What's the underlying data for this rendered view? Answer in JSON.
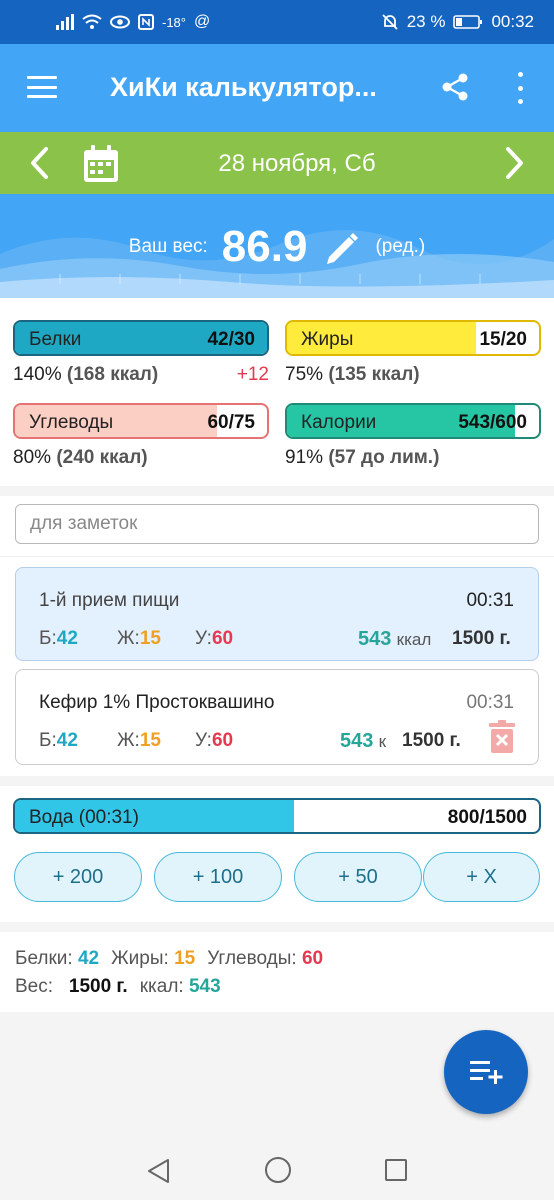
{
  "status_bar": {
    "temperature": "-18°",
    "battery": "23 %",
    "time": "00:32"
  },
  "app_bar": {
    "title": "ХиКи калькулятор..."
  },
  "date_bar": {
    "date": "28 ноября, Сб"
  },
  "weight": {
    "label": "Ваш вес:",
    "value": "86.9",
    "edit_label": "(ред.)"
  },
  "macros": {
    "protein": {
      "label": "Белки",
      "value": "42/30",
      "percent_text": "140%",
      "kcal_text": "(168 ккал)",
      "diff": "+12",
      "fill": 1.0,
      "color": "#1fa8c4",
      "border": "#1a6680"
    },
    "fat": {
      "label": "Жиры",
      "value": "15/20",
      "percent_text": "75%",
      "kcal_text": "(135 ккал)",
      "fill": 0.75,
      "color": "#ffeb3b",
      "border": "#e0b800"
    },
    "carbs": {
      "label": "Углеводы",
      "value": "60/75",
      "percent_text": "80%",
      "kcal_text": "(240 ккал)",
      "fill": 0.8,
      "color": "#fccfc5",
      "border": "#e57373"
    },
    "calories": {
      "label": "Калории",
      "value": "543/600",
      "percent_text": "91%",
      "kcal_text": "(57 до лим.)",
      "fill": 0.905,
      "color": "#26c6a5",
      "border": "#1f8a75"
    }
  },
  "notes": {
    "placeholder": "для заметок"
  },
  "meal_summary": {
    "title": "1-й прием пищи",
    "time": "00:31",
    "b_label": "Б:",
    "b_value": "42",
    "z_label": "Ж:",
    "z_value": "15",
    "u_label": "У:",
    "u_value": "60",
    "kcal_value": "543",
    "kcal_unit": "ккал",
    "weight": "1500 г."
  },
  "meal_item": {
    "title": "Кефир 1% Простоквашино",
    "time": "00:31",
    "b_label": "Б:",
    "b_value": "42",
    "z_label": "Ж:",
    "z_value": "15",
    "u_label": "У:",
    "u_value": "60",
    "kcal_value": "543",
    "kcal_unit": "к",
    "weight": "1500 г."
  },
  "water": {
    "label": "Вода (00:31)",
    "value": "800/1500",
    "fill": 0.533,
    "buttons": [
      "+ 200",
      "+ 100",
      "+ 50",
      "+ X"
    ]
  },
  "totals": {
    "protein_label": "Белки:",
    "protein_value": "42",
    "fat_label": "Жиры:",
    "fat_value": "15",
    "carbs_label": "Углеводы:",
    "carbs_value": "60",
    "weight_label": "Вес:",
    "weight_value": "1500 г.",
    "kcal_label": "ккал:",
    "kcal_value": "543"
  },
  "icons": {
    "menu": "menu-icon",
    "share": "share-icon",
    "more": "more-vert-icon",
    "calendar": "calendar-icon",
    "pencil": "pencil-icon",
    "trash": "trash-icon",
    "fab": "playlist-add-icon"
  }
}
